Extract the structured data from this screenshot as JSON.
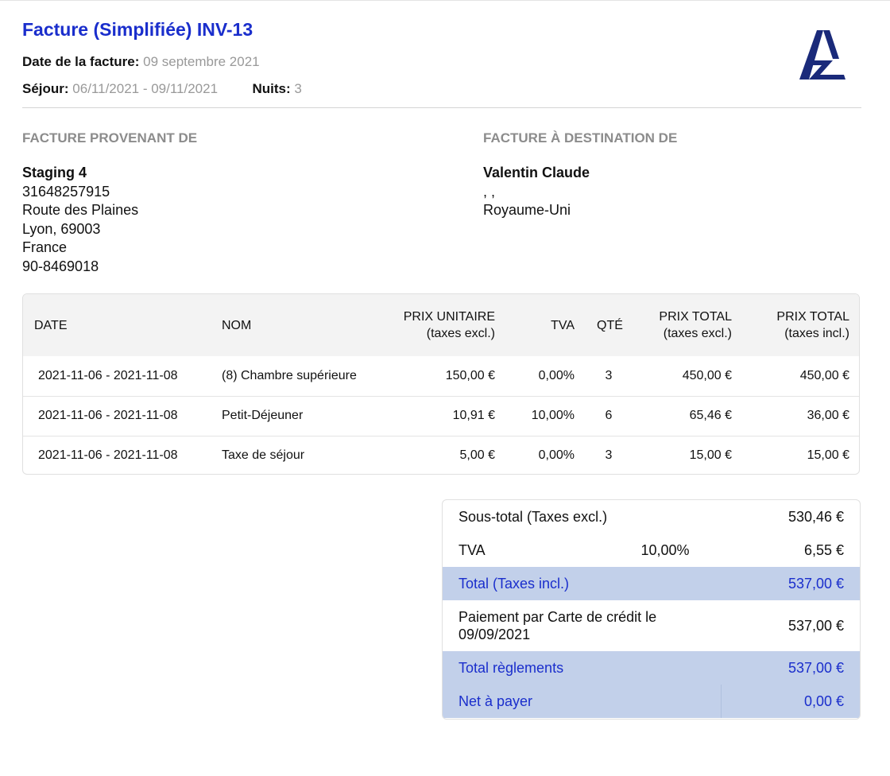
{
  "header": {
    "title": "Facture (Simplifiée) INV-13",
    "date_label": "Date de la facture:",
    "date_value": "09 septembre 2021",
    "stay_label": "Séjour:",
    "stay_value": "06/11/2021 - 09/11/2021",
    "nights_label": "Nuits:",
    "nights_value": "3"
  },
  "brand": {
    "logo_icon": "az-logo-icon",
    "logo_color": "#1a2a7a"
  },
  "from": {
    "heading": "FACTURE PROVENANT DE",
    "name": "Staging 4",
    "lines": [
      "31648257915",
      "Route des Plaines",
      "Lyon, 69003",
      "France",
      "90-8469018"
    ]
  },
  "to": {
    "heading": "FACTURE À DESTINATION DE",
    "name": "Valentin Claude",
    "lines": [
      ", ,",
      "Royaume-Uni"
    ]
  },
  "items": {
    "headers": {
      "date": "DATE",
      "name": "NOM",
      "unit_price": "PRIX UNITAIRE",
      "unit_price_sub": "(taxes excl.)",
      "vat": "TVA",
      "qty": "QTÉ",
      "total_excl": "PRIX TOTAL",
      "total_excl_sub": "(taxes excl.)",
      "total_incl": "PRIX TOTAL",
      "total_incl_sub": "(taxes incl.)"
    },
    "rows": [
      {
        "date": "2021-11-06 - 2021-11-08",
        "name": "(8) Chambre supérieure",
        "unit_price": "150,00 €",
        "vat": "0,00%",
        "qty": "3",
        "total_excl": "450,00 €",
        "total_incl": "450,00 €"
      },
      {
        "date": "2021-11-06 - 2021-11-08",
        "name": "Petit-Déjeuner",
        "unit_price": "10,91 €",
        "vat": "10,00%",
        "qty": "6",
        "total_excl": "65,46 €",
        "total_incl": "36,00 €"
      },
      {
        "date": "2021-11-06 - 2021-11-08",
        "name": "Taxe de séjour",
        "unit_price": "5,00 €",
        "vat": "0,00%",
        "qty": "3",
        "total_excl": "15,00 €",
        "total_incl": "15,00 €"
      }
    ]
  },
  "totals": {
    "subtotal_label": "Sous-total (Taxes excl.)",
    "subtotal_value": "530,46 €",
    "vat_label": "TVA",
    "vat_rate": "10,00%",
    "vat_value": "6,55 €",
    "total_label": "Total (Taxes incl.)",
    "total_value": "537,00 €",
    "payment_label": "Paiement par Carte de crédit le 09/09/2021",
    "payment_value": "537,00 €",
    "settled_label": "Total règlements",
    "settled_value": "537,00 €",
    "due_label": "Net à payer",
    "due_value": "0,00 €"
  },
  "colors": {
    "accent": "#1a2ecc",
    "highlight": "#c2d0ea",
    "muted": "#8c8c8c"
  }
}
